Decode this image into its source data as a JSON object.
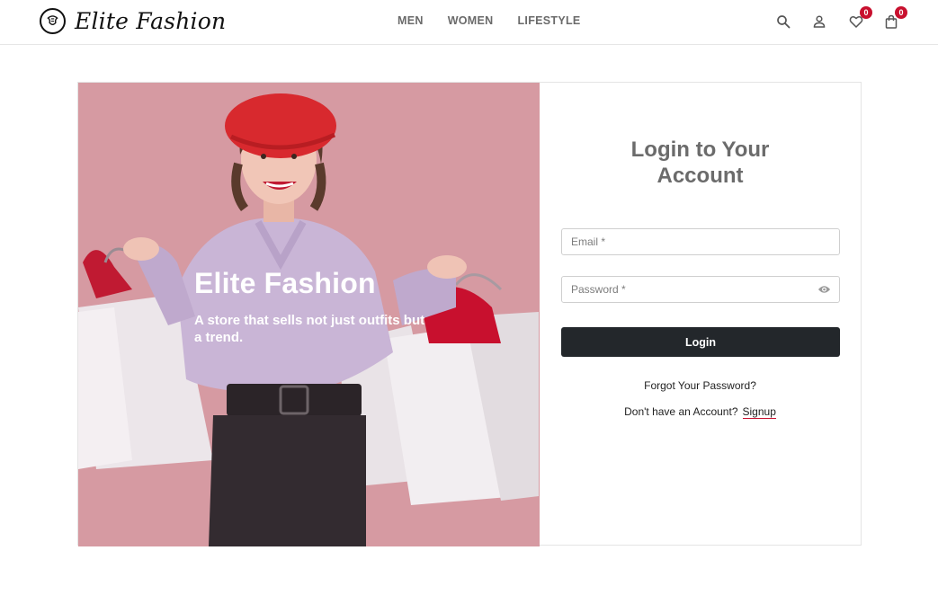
{
  "brand": {
    "name": "Elite Fashion",
    "logo_icon": "logo-emblem-icon"
  },
  "nav": {
    "items": [
      "MEN",
      "WOMEN",
      "LIFESTYLE"
    ]
  },
  "header_icons": {
    "search": "search-icon",
    "account": "user-icon",
    "wishlist": {
      "icon": "heart-icon",
      "count": "0"
    },
    "cart": {
      "icon": "bag-icon",
      "count": "0"
    },
    "badge_color": "#c8102e"
  },
  "hero": {
    "title": "Elite Fashion",
    "subtitle": "A store that sells not just outfits but a trend.",
    "background_color": "#d69aa2"
  },
  "login": {
    "title": "Login to Your Account",
    "email_placeholder": "Email *",
    "email_value": "",
    "password_placeholder": "Password *",
    "password_value": "",
    "password_toggle_icon": "eye-icon",
    "submit_label": "Login",
    "forgot_label": "Forgot Your Password?",
    "signup_prompt": "Don't have an Account?",
    "signup_label": "Signup",
    "button_color": "#23272b"
  }
}
